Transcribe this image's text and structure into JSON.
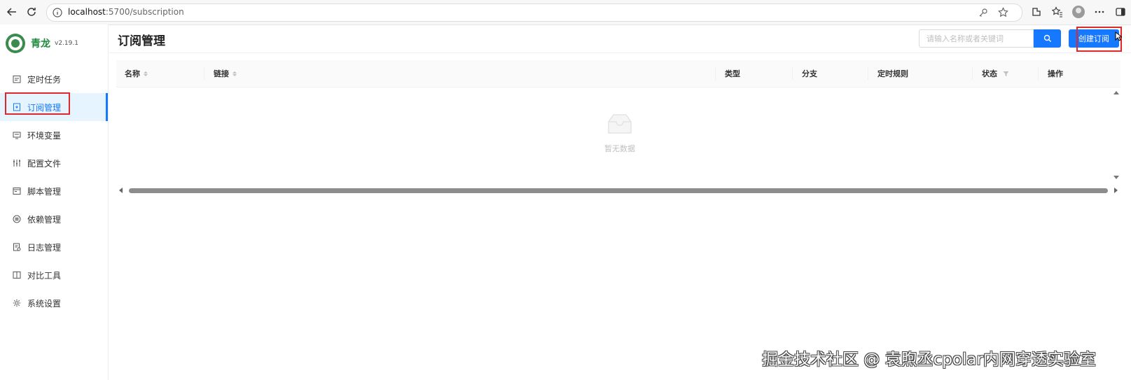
{
  "browser": {
    "url_host": "localhost",
    "url_path": ":5700/subscription"
  },
  "app": {
    "name": "青龙",
    "version": "v2.19.1"
  },
  "sidebar": {
    "items": [
      {
        "label": "定时任务",
        "icon": "calendar-icon",
        "active": false
      },
      {
        "label": "订阅管理",
        "icon": "subscription-icon",
        "active": true
      },
      {
        "label": "环境变量",
        "icon": "monitor-icon",
        "active": false
      },
      {
        "label": "配置文件",
        "icon": "sliders-icon",
        "active": false
      },
      {
        "label": "脚本管理",
        "icon": "script-icon",
        "active": false
      },
      {
        "label": "依赖管理",
        "icon": "dependency-icon",
        "active": false
      },
      {
        "label": "日志管理",
        "icon": "log-icon",
        "active": false
      },
      {
        "label": "对比工具",
        "icon": "diff-icon",
        "active": false
      },
      {
        "label": "系统设置",
        "icon": "gear-icon",
        "active": false
      }
    ]
  },
  "main": {
    "title": "订阅管理",
    "search_placeholder": "请输入名称或者关键词",
    "create_label": "创建订阅",
    "table": {
      "columns": [
        "名称",
        "链接",
        "类型",
        "分支",
        "定时规则",
        "状态",
        "操作"
      ],
      "rows": [],
      "empty_text": "暂无数据"
    }
  },
  "watermark": "掘金技术社区 @ 袁煦丞cpolar内网穿透实验室",
  "colors": {
    "primary": "#1677ff",
    "highlight": "#e0282b",
    "active_bg": "#e6f4ff",
    "brand_green": "#1f8a3d"
  }
}
